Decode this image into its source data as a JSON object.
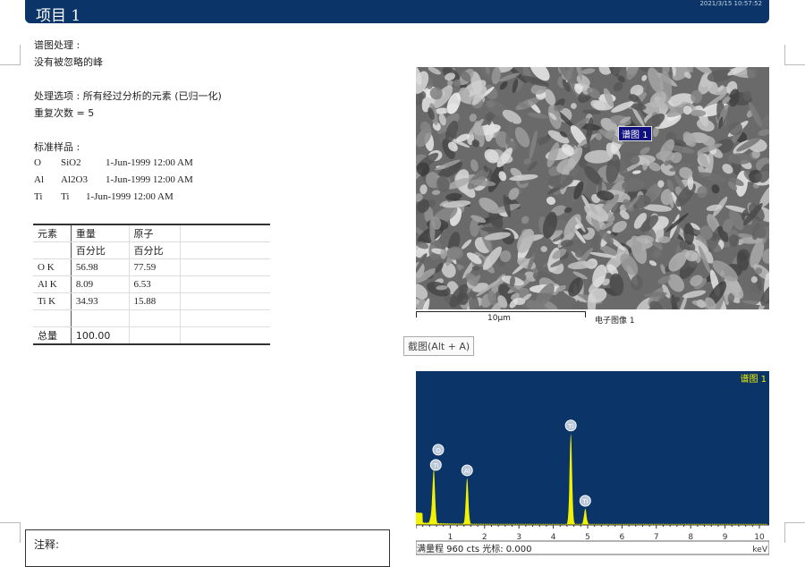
{
  "header": {
    "title": "项目 1",
    "timestamp": "2021/3/15 10:57:52"
  },
  "processing": {
    "label": "谱图处理 :",
    "value": "没有被忽略的峰"
  },
  "options": {
    "label": "处理选项 : 所有经过分析的元素 (已归一化)",
    "repeat": "重复次数 = 5"
  },
  "standards": {
    "label": "标准样品 :",
    "items": [
      {
        "el": "O",
        "std": "SiO2",
        "date": "1-Jun-1999 12:00 AM"
      },
      {
        "el": "Al",
        "std": "Al2O3",
        "date": "1-Jun-1999 12:00 AM"
      },
      {
        "el": "Ti",
        "std": "Ti",
        "date": "1-Jun-1999 12:00 AM"
      }
    ]
  },
  "table": {
    "headers": [
      "元素",
      "重量",
      "原子"
    ],
    "subheaders": [
      "",
      "百分比",
      "百分比"
    ],
    "rows": [
      [
        "O K",
        "56.98",
        "77.59"
      ],
      [
        "Al K",
        "8.09",
        "6.53"
      ],
      [
        "Ti K",
        "34.93",
        "15.88"
      ],
      [
        "",
        "",
        ""
      ],
      [
        "总量",
        "100.00",
        ""
      ]
    ]
  },
  "image": {
    "marker": "谱图 1",
    "scale": "10µm",
    "caption": "电子图像 1"
  },
  "snapshot_button": "截图(Alt + A)",
  "note_label": "注释:",
  "chart_data": {
    "type": "line",
    "title": "谱图 1",
    "xlabel": "keV",
    "xlim": [
      0,
      10
    ],
    "ylim": [
      0,
      960
    ],
    "full_scale": "满量程 960 cts 光标: 0.000",
    "ticks": [
      "1",
      "2",
      "3",
      "4",
      "5",
      "6",
      "7",
      "8",
      "9",
      "10"
    ],
    "peaks": [
      {
        "label": "Ti",
        "x": 0.45,
        "y": 40
      },
      {
        "label": "O",
        "x": 0.52,
        "y": 330
      },
      {
        "label": "Al",
        "x": 1.49,
        "y": 285
      },
      {
        "label": "Ti",
        "x": 4.51,
        "y": 565
      },
      {
        "label": "Ti",
        "x": 4.93,
        "y": 95
      }
    ],
    "colors": {
      "bg": "#0b3568",
      "trace": "#f2f200"
    }
  }
}
